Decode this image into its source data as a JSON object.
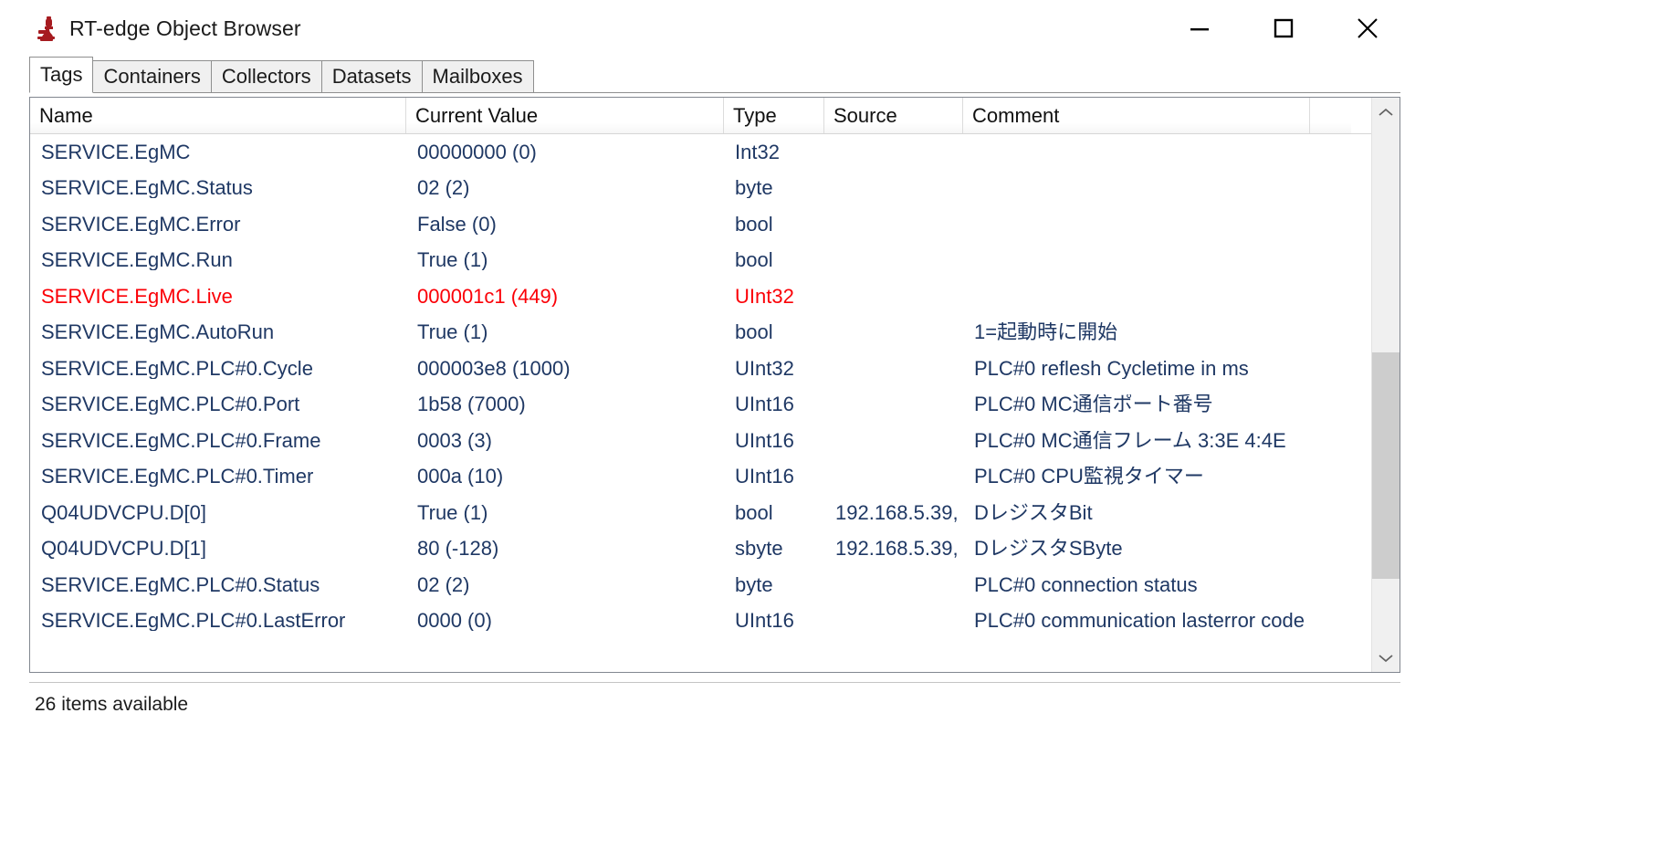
{
  "window": {
    "title": "RT-edge Object Browser",
    "icon": "microscope-icon",
    "accent_color": "#1f3864",
    "alert_color": "#fb0007",
    "icon_color": "#a61b20",
    "controls": {
      "minimize": "minimize-icon",
      "maximize": "maximize-icon",
      "close": "close-icon"
    }
  },
  "tabs": [
    {
      "label": "Tags",
      "selected": true
    },
    {
      "label": "Containers",
      "selected": false
    },
    {
      "label": "Collectors",
      "selected": false
    },
    {
      "label": "Datasets",
      "selected": false
    },
    {
      "label": "Mailboxes",
      "selected": false
    }
  ],
  "table": {
    "columns": [
      "Name",
      "Current Value",
      "Type",
      "Source",
      "Comment",
      ""
    ],
    "rows": [
      {
        "name": "SERVICE.EgMC",
        "value": "00000000 (0)",
        "type": "Int32",
        "source": "",
        "comment": "",
        "alert": false
      },
      {
        "name": "SERVICE.EgMC.Status",
        "value": "02 (2)",
        "type": "byte",
        "source": "",
        "comment": "",
        "alert": false
      },
      {
        "name": "SERVICE.EgMC.Error",
        "value": "False (0)",
        "type": "bool",
        "source": "",
        "comment": "",
        "alert": false
      },
      {
        "name": "SERVICE.EgMC.Run",
        "value": "True (1)",
        "type": "bool",
        "source": "",
        "comment": "",
        "alert": false
      },
      {
        "name": "SERVICE.EgMC.Live",
        "value": "000001c1 (449)",
        "type": "UInt32",
        "source": "",
        "comment": "",
        "alert": true
      },
      {
        "name": "SERVICE.EgMC.AutoRun",
        "value": "True (1)",
        "type": "bool",
        "source": "",
        "comment": "1=起動時に開始",
        "alert": false
      },
      {
        "name": "SERVICE.EgMC.PLC#0.Cycle",
        "value": "000003e8 (1000)",
        "type": "UInt32",
        "source": "",
        "comment": "PLC#0 reflesh Cycletime in ms",
        "alert": false
      },
      {
        "name": "SERVICE.EgMC.PLC#0.Port",
        "value": "1b58 (7000)",
        "type": "UInt16",
        "source": "",
        "comment": "PLC#0 MC通信ポート番号",
        "alert": false
      },
      {
        "name": "SERVICE.EgMC.PLC#0.Frame",
        "value": "0003 (3)",
        "type": "UInt16",
        "source": "",
        "comment": "PLC#0 MC通信フレーム 3:3E  4:4E",
        "alert": false
      },
      {
        "name": "SERVICE.EgMC.PLC#0.Timer",
        "value": "000a (10)",
        "type": "UInt16",
        "source": "",
        "comment": "PLC#0 CPU監視タイマー",
        "alert": false
      },
      {
        "name": "Q04UDVCPU.D[0]",
        "value": "True (1)",
        "type": "bool",
        "source": "192.168.5.39,",
        "comment": "DレジスタBit",
        "alert": false
      },
      {
        "name": "Q04UDVCPU.D[1]",
        "value": "80 (-128)",
        "type": "sbyte",
        "source": "192.168.5.39,",
        "comment": "DレジスタSByte",
        "alert": false
      },
      {
        "name": "SERVICE.EgMC.PLC#0.Status",
        "value": "02 (2)",
        "type": "byte",
        "source": "",
        "comment": "PLC#0 connection status",
        "alert": false
      },
      {
        "name": "SERVICE.EgMC.PLC#0.LastError",
        "value": "0000 (0)",
        "type": "UInt16",
        "source": "",
        "comment": "PLC#0 communication lasterror code",
        "alert": false
      }
    ]
  },
  "scrollbar": {
    "up_arrow": "chevron-up-icon",
    "down_arrow": "chevron-down-icon"
  },
  "status": {
    "text": "26 items available"
  }
}
